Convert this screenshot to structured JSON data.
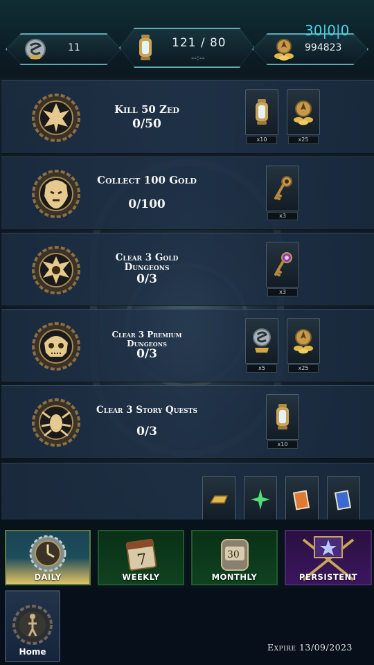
{
  "header": {
    "currency_left": {
      "value": "11",
      "icon": "silver-token-icon"
    },
    "energy": {
      "value": "121 / 80",
      "timer": "--:--",
      "icon": "lantern-icon"
    },
    "currency_right": {
      "value": "994823",
      "icon": "gold-pile-icon"
    },
    "fps_overlay": "30|0|0"
  },
  "quests": [
    {
      "title": "Kill 50 Zed",
      "progress": "0/50",
      "emblem": "zed-crest-icon",
      "rewards": [
        {
          "icon": "lantern-icon",
          "qty": "x10"
        },
        {
          "icon": "gold-pile-icon",
          "qty": "x25"
        }
      ]
    },
    {
      "title": "Collect 100 Gold",
      "progress": "0/100",
      "emblem": "lion-crest-icon",
      "rewards": [
        {
          "icon": "bronze-key-icon",
          "qty": "x3"
        }
      ]
    },
    {
      "title": "Clear 3 Gold Dungeons",
      "progress": "0/3",
      "emblem": "spider-crest-icon",
      "rewards": [
        {
          "icon": "purple-key-icon",
          "qty": "x3"
        }
      ]
    },
    {
      "title": "Clear 3 Premium Dungeons",
      "progress": "0/3",
      "emblem": "skull-crest-icon",
      "rewards": [
        {
          "icon": "silver-token-icon",
          "qty": "x5"
        },
        {
          "icon": "gold-pile-icon",
          "qty": "x25"
        }
      ]
    },
    {
      "title": "Clear 3 Story Quests",
      "progress": "0/3",
      "emblem": "bug-crest-icon",
      "rewards": [
        {
          "icon": "lantern-icon",
          "qty": "x10"
        }
      ]
    }
  ],
  "partial_row_rewards": [
    {
      "icon": "gold-bar-icon"
    },
    {
      "icon": "green-star-icon"
    },
    {
      "icon": "orange-card-icon"
    },
    {
      "icon": "blue-card-icon"
    }
  ],
  "tabs": [
    {
      "id": "daily",
      "label": "DAILY",
      "icon": "clock-gear-icon",
      "active": true
    },
    {
      "id": "weekly",
      "label": "WEEKLY",
      "icon": "calendar-7-icon",
      "active": false
    },
    {
      "id": "monthly",
      "label": "MONTHLY",
      "icon": "calendar-30-icon",
      "active": false
    },
    {
      "id": "persistent",
      "label": "PERSISTENT",
      "icon": "crossed-staves-star-icon",
      "active": false
    }
  ],
  "home": {
    "label": "Home",
    "icon": "figure-gear-icon"
  },
  "expire_text": "Expire 13/09/2023",
  "colors": {
    "accent_teal": "#5fa9b5",
    "gold": "#c9a55a",
    "tab_green": "#0f4220",
    "tab_purple": "#3b1660",
    "fps_cyan": "#3fd6ea"
  }
}
